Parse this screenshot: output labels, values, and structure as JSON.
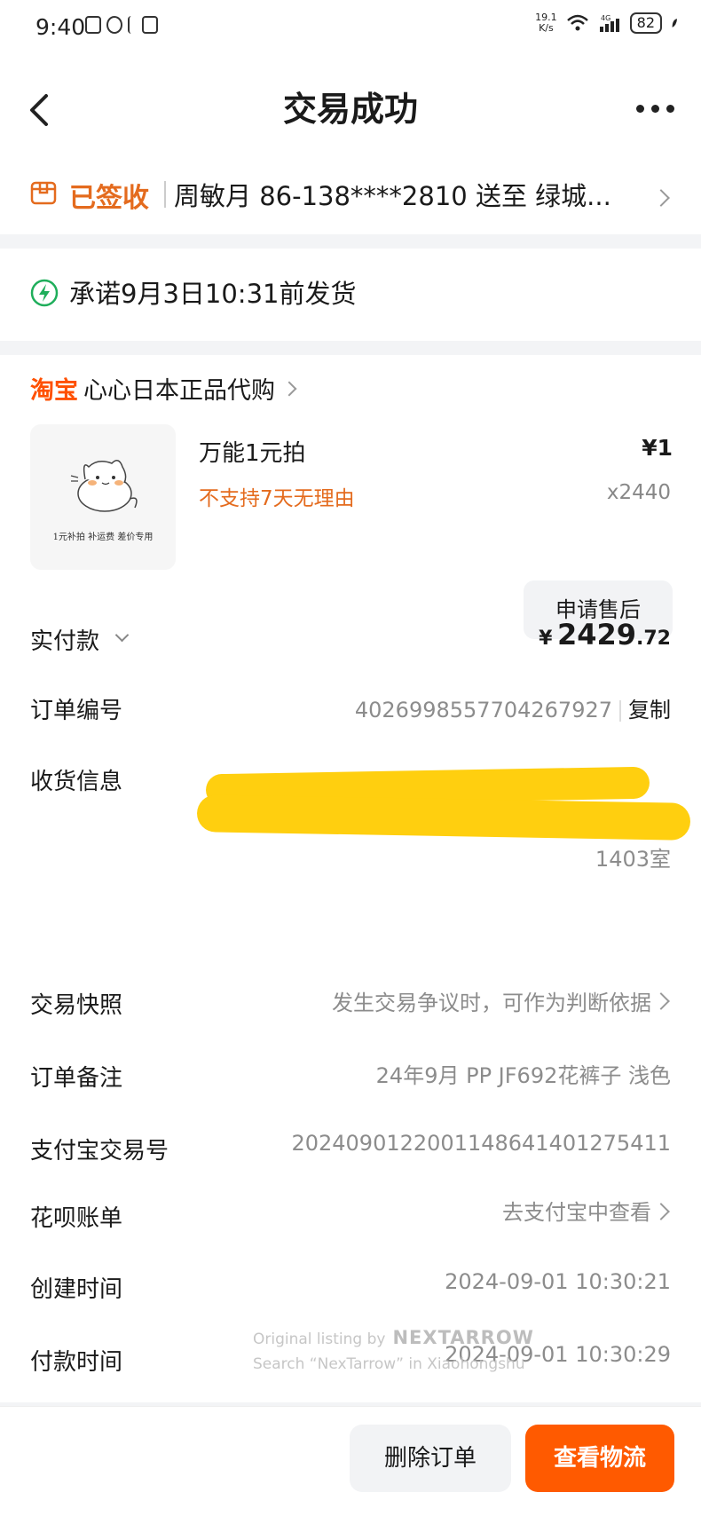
{
  "status_bar": {
    "time": "9:40",
    "net_speed_value": "19.1",
    "net_speed_unit": "K/s",
    "network": "4G",
    "battery": "82"
  },
  "nav": {
    "title": "交易成功"
  },
  "address": {
    "status": "已签收",
    "text": "周敏月 86-138****2810 送至 绿城..."
  },
  "promise": {
    "text": "承诺9月3日10:31前发货"
  },
  "shop": {
    "brand": "淘宝",
    "name": "心心日本正品代购"
  },
  "item": {
    "title": "万能1元拍",
    "tag": "不支持7天无理由",
    "price": "¥1",
    "quantity": "x2440",
    "thumbnail_caption": "1元补拍 补运费 差价专用"
  },
  "after_sales_button": "申请售后",
  "paid": {
    "label": "实付款",
    "currency": "¥",
    "integer": "2429",
    "decimal": ".72"
  },
  "details": {
    "order_no": {
      "label": "订单编号",
      "value": "4026998557704267927",
      "copy": "复制"
    },
    "shipping": {
      "label": "收货信息",
      "value_tail": "1403室"
    },
    "snapshot": {
      "label": "交易快照",
      "value": "发生交易争议时，可作为判断依据"
    },
    "remark": {
      "label": "订单备注",
      "value": "24年9月 PP JF692花裤子 浅色"
    },
    "alipay_no": {
      "label": "支付宝交易号",
      "value": "2024090122001148641401275411"
    },
    "huabei": {
      "label": "花呗账单",
      "value": "去支付宝中查看"
    },
    "created": {
      "label": "创建时间",
      "value": "2024-09-01 10:30:21"
    },
    "paid_time": {
      "label": "付款时间",
      "value": "2024-09-01 10:30:29"
    }
  },
  "watermark": {
    "line1": "Original listing by",
    "brand": "NEXTARROW",
    "line2": "Search “NexTarrow” in Xiaohongshu"
  },
  "bottom": {
    "delete_label": "删除订单",
    "logistics_label": "查看物流"
  },
  "colors": {
    "accent": "#ff5a00",
    "status_orange": "#e46b1e",
    "redaction": "#ffcf0f"
  }
}
